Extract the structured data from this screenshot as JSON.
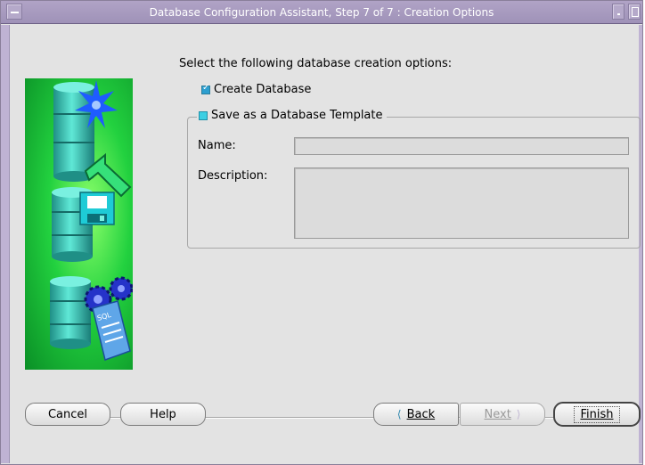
{
  "window": {
    "title": "Database Configuration Assistant, Step 7 of 7 : Creation Options"
  },
  "heading": "Select the following database creation options:",
  "options": {
    "create_database": {
      "label": "Create Database",
      "checked": true
    },
    "save_template": {
      "label": "Save as a Database Template",
      "checked": false
    }
  },
  "template": {
    "name_label": "Name:",
    "name_value": "",
    "description_label": "Description:",
    "description_value": ""
  },
  "buttons": {
    "cancel": "Cancel",
    "help": "Help",
    "back": "Back",
    "next": "Next",
    "finish": "Finish"
  },
  "illustration": {
    "sql_text": "SQL"
  },
  "colors": {
    "titlebar": "#a89bbf",
    "background": "#e3e3e3",
    "illustration_green": "#22d13f",
    "cylinder_teal": "#3ed6c4",
    "checkbox_accent": "#2d9fd0"
  },
  "icons": [
    "window-menu-icon",
    "minimize-icon",
    "maximize-icon",
    "database-icon",
    "star-icon",
    "arrow-icon",
    "floppy-disk-icon",
    "gear-icon",
    "sql-script-icon",
    "back-arrow-icon",
    "next-arrow-icon"
  ]
}
